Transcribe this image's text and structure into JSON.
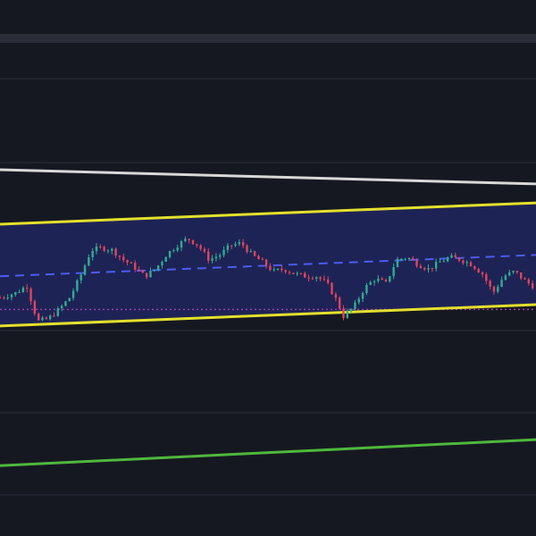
{
  "chart_data": {
    "type": "candlestick",
    "title": "",
    "xlabel": "",
    "ylabel": "",
    "grid": true,
    "legend": "none",
    "xlim": [
      0,
      100
    ],
    "ylim": [
      0,
      100
    ],
    "price_path": [
      [
        0,
        46
      ],
      [
        3,
        48
      ],
      [
        5,
        51
      ],
      [
        7,
        36
      ],
      [
        9,
        37
      ],
      [
        11,
        41
      ],
      [
        13,
        46
      ],
      [
        15,
        55
      ],
      [
        17,
        66
      ],
      [
        19,
        67
      ],
      [
        21,
        66
      ],
      [
        23,
        62
      ],
      [
        25,
        59
      ],
      [
        27,
        55
      ],
      [
        29,
        58
      ],
      [
        31,
        64
      ],
      [
        33,
        68
      ],
      [
        35,
        71
      ],
      [
        37,
        68
      ],
      [
        39,
        62
      ],
      [
        41,
        64
      ],
      [
        43,
        68
      ],
      [
        45,
        69
      ],
      [
        47,
        64
      ],
      [
        49,
        61
      ],
      [
        51,
        57
      ],
      [
        53,
        58
      ],
      [
        55,
        56
      ],
      [
        57,
        55
      ],
      [
        59,
        55
      ],
      [
        61,
        52
      ],
      [
        63,
        44
      ],
      [
        64,
        38
      ],
      [
        66,
        42
      ],
      [
        68,
        50
      ],
      [
        70,
        54
      ],
      [
        72,
        52
      ],
      [
        74,
        62
      ],
      [
        76,
        63
      ],
      [
        78,
        60
      ],
      [
        80,
        58
      ],
      [
        82,
        61
      ],
      [
        84,
        63
      ],
      [
        86,
        62
      ],
      [
        88,
        60
      ],
      [
        90,
        56
      ],
      [
        92,
        48
      ],
      [
        94,
        55
      ],
      [
        96,
        57
      ],
      [
        98,
        53
      ],
      [
        100,
        50
      ]
    ],
    "channel": {
      "upper": [
        [
          0,
          77
        ],
        [
          100,
          86
        ]
      ],
      "lower": [
        [
          0,
          34
        ],
        [
          100,
          43
        ]
      ],
      "fill": "#1f2458",
      "line_color": "#e3e02c"
    },
    "midline": {
      "points": [
        [
          0,
          55
        ],
        [
          100,
          64
        ]
      ],
      "color": "#4b5cf0",
      "style": "dashed"
    },
    "support_dotted": {
      "points": [
        [
          0,
          41
        ],
        [
          100,
          41
        ]
      ],
      "color": "#9b3fa7",
      "style": "dotted"
    },
    "upper_trendline": {
      "points": [
        [
          0,
          100
        ],
        [
          100,
          94
        ]
      ],
      "color": "#d8d8d8"
    },
    "lower_trendline": {
      "points": [
        [
          0,
          -25
        ],
        [
          100,
          -14
        ]
      ],
      "color": "#4fb83c"
    },
    "colors": {
      "background": "#161821",
      "grid": "#2a2d3a",
      "up": "#2fae93",
      "down": "#e0445f",
      "top_band": "#2b2e38"
    }
  }
}
